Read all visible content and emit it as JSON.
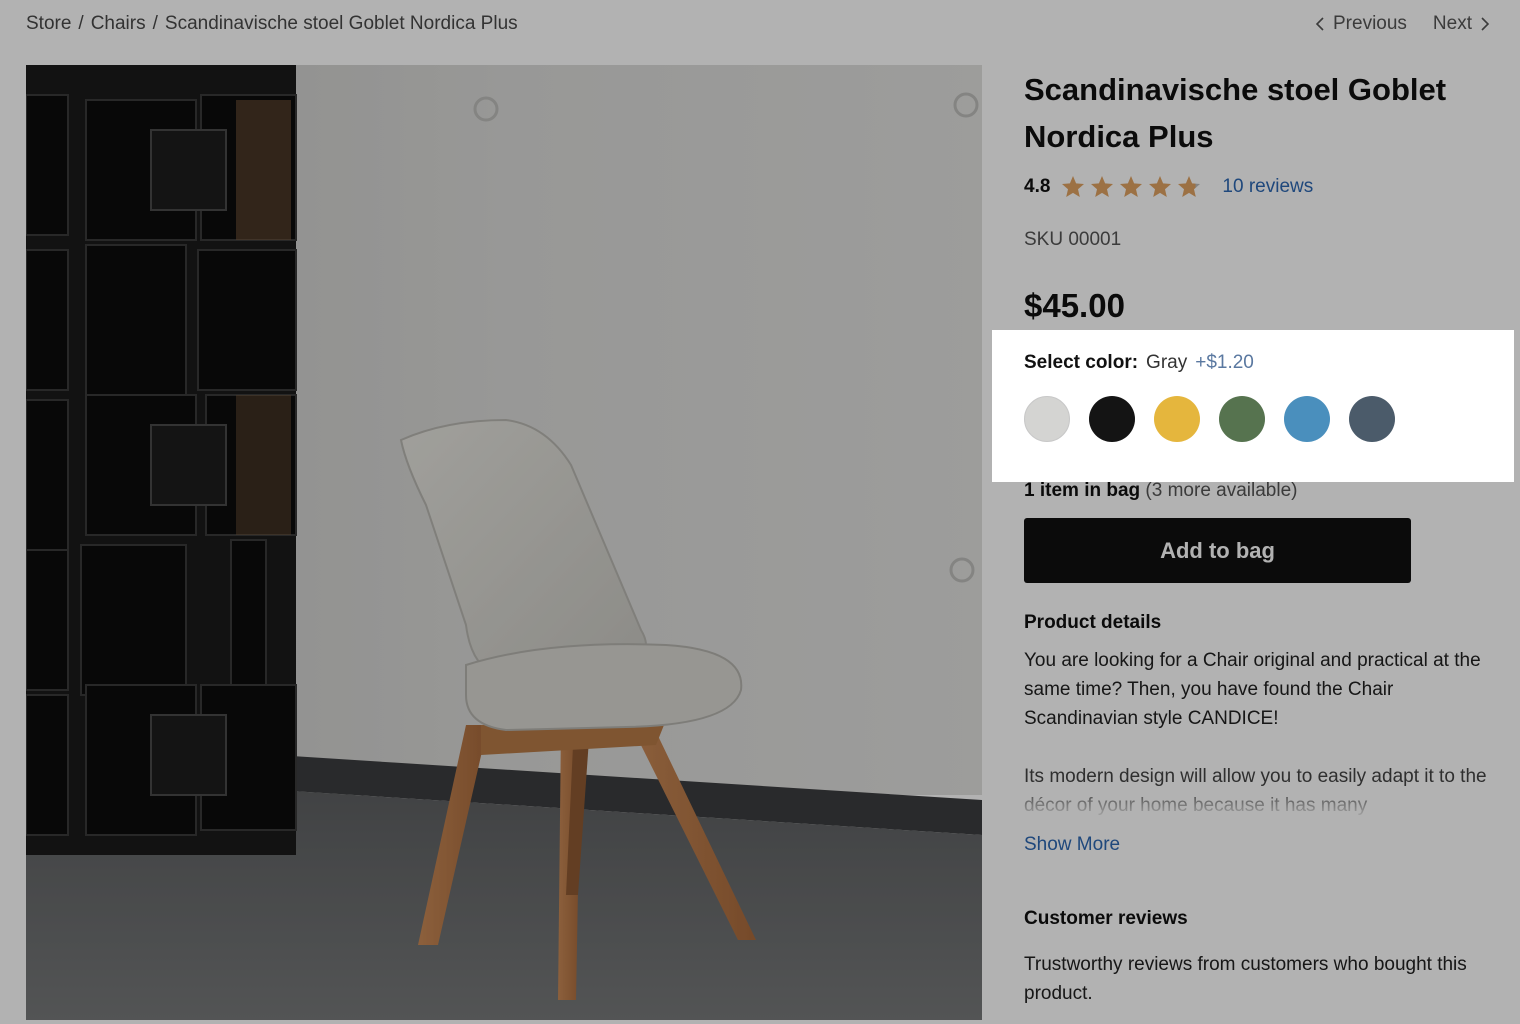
{
  "breadcrumb": {
    "items": [
      "Store",
      "Chairs",
      "Scandinavische stoel Goblet Nordica Plus"
    ],
    "separator": "/"
  },
  "pager": {
    "previous": "Previous",
    "next": "Next"
  },
  "product": {
    "title": "Scandinavische stoel Goblet Nordica Plus",
    "rating": "4.8",
    "rating_value": 4.8,
    "rating_max": 5,
    "reviews_link": "10 reviews",
    "sku": "SKU 00001",
    "price": "$45.00"
  },
  "color": {
    "label": "Select color:",
    "selected": "Gray",
    "extra_price": "+$1.20",
    "swatches": [
      {
        "name": "gray",
        "hex": "#d4d4d2"
      },
      {
        "name": "black",
        "hex": "#141414"
      },
      {
        "name": "yellow",
        "hex": "#e5b63d"
      },
      {
        "name": "green",
        "hex": "#56734f"
      },
      {
        "name": "blue",
        "hex": "#4a8fbd"
      },
      {
        "name": "slate",
        "hex": "#4b5b6a"
      }
    ]
  },
  "bag": {
    "count_text": "1 item in bag",
    "available_text": "(3 more available)",
    "add_button": "Add to bag"
  },
  "details": {
    "heading": "Product details",
    "paragraph1": "You are looking for a Chair original and practical at the same time? Then, you have found the Chair Scandinavian style CANDICE!",
    "paragraph2": "Its modern design will allow you to easily adapt it to the décor of your home because it has many",
    "show_more": "Show More"
  },
  "reviews": {
    "heading": "Customer reviews",
    "text": "Trustworthy reviews from customers who bought this product."
  },
  "colors": {
    "star": "#e0a262",
    "link": "#2d67b2",
    "button": "#111111",
    "overlay": "rgba(0,0,0,0.30)"
  }
}
